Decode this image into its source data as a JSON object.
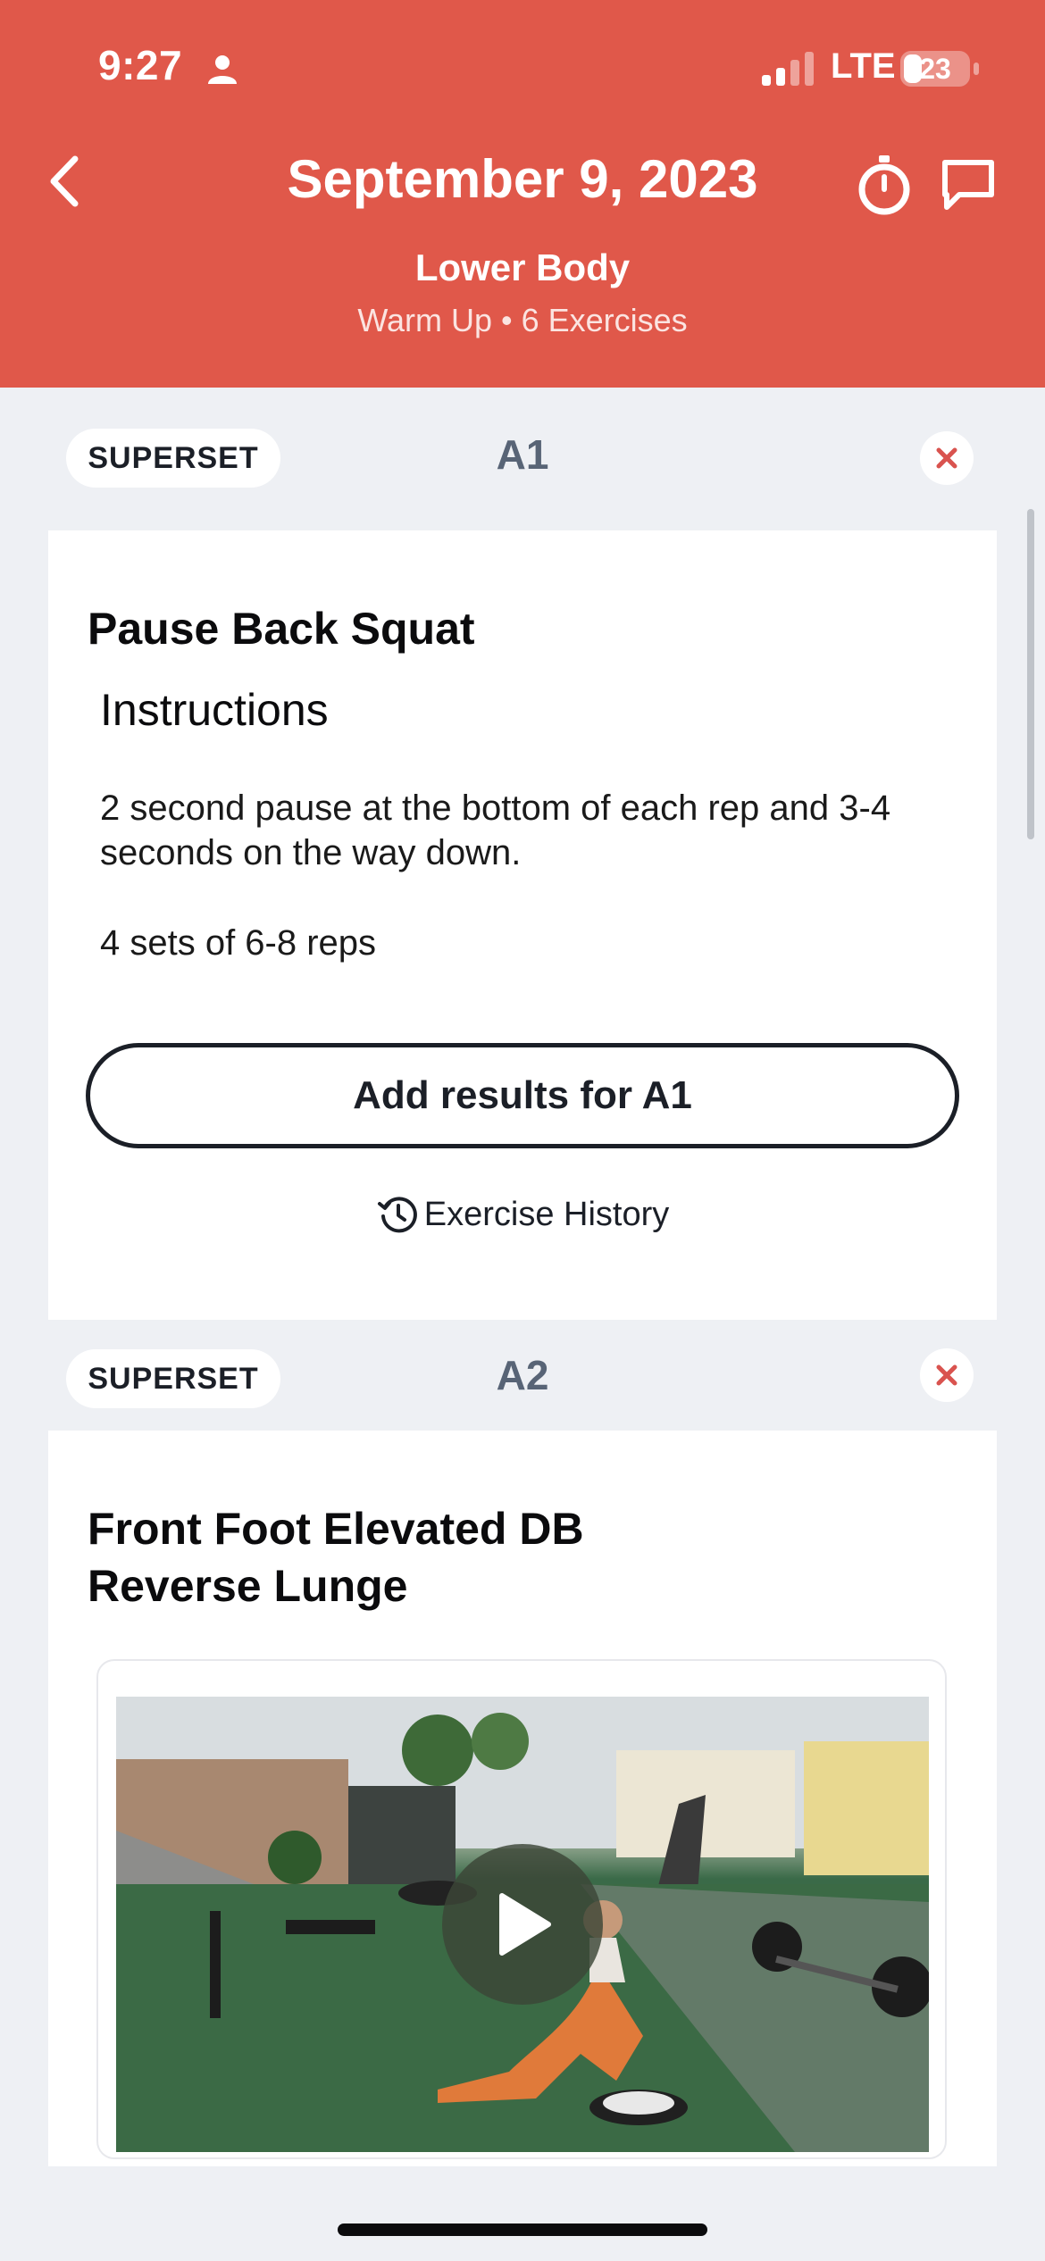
{
  "status_bar": {
    "time": "9:27",
    "network": "LTE",
    "battery": "23"
  },
  "header": {
    "title": "September 9, 2023",
    "workout_name": "Lower Body",
    "workout_subtitle": "Warm Up • 6 Exercises",
    "background_color": "#e0584a",
    "icons": [
      "back-chevron-icon",
      "stopwatch-icon",
      "chat-bubble-icon"
    ]
  },
  "exercises": [
    {
      "group": "SUPERSET",
      "label": "A1",
      "title": "Pause Back Squat",
      "instructions_heading": "Instructions",
      "instructions_body": "2 second pause at the bottom of each rep and 3-4 seconds on the way down.",
      "instructions_sets": "4 sets of 6-8 reps",
      "results_button": "Add results for A1",
      "history_link": "Exercise History"
    },
    {
      "group": "SUPERSET",
      "label": "A2",
      "title_line1": "Front Foot Elevated DB",
      "title_line2": "Reverse Lunge",
      "video": "exercise-video-thumbnail"
    }
  ],
  "accent_colors": {
    "close_icon": "#d9534f",
    "label_gray": "#586476"
  }
}
